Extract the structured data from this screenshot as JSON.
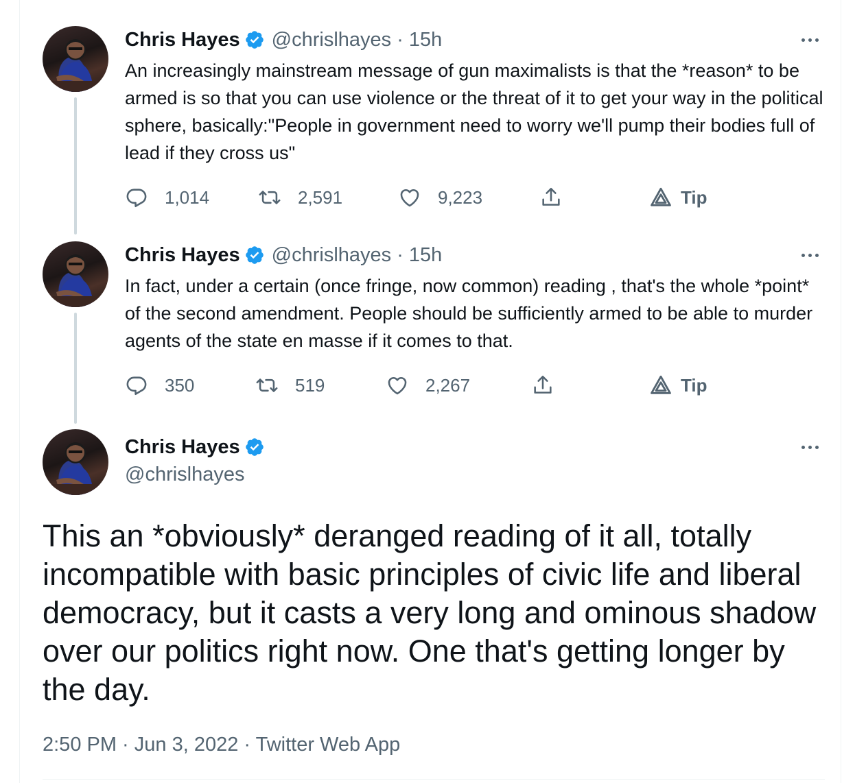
{
  "tweets": [
    {
      "name": "Chris Hayes",
      "meta": "@chrislhayes · 15h",
      "text": "An increasingly mainstream message of gun maximalists is that the *reason* to be armed is so that you can use violence or the threat of it to get your way in the political sphere, basically:\"People in government need to worry we'll pump their bodies full of lead if they cross us\"",
      "replies": "1,014",
      "retweets": "2,591",
      "likes": "9,223",
      "tip": "Tip"
    },
    {
      "name": "Chris Hayes",
      "meta": "@chrislhayes · 15h",
      "text": "In fact, under a certain (once fringe, now common) reading , that's the whole *point* of the second amendment. People should be sufficiently armed to be able to murder agents of the state en masse if it comes to that.",
      "replies": "350",
      "retweets": "519",
      "likes": "2,267",
      "tip": "Tip"
    }
  ],
  "main": {
    "name": "Chris Hayes",
    "handle": "@chrislhayes",
    "text": "This an *obviously* deranged reading of it all, totally incompatible with basic principles of civic life and liberal democracy, but it casts a very long and ominous shadow over our politics right now. One that's getting longer by the day.",
    "timestamp": "2:50 PM · Jun 3, 2022 · Twitter Web App"
  },
  "colors": {
    "verified": "#1d9bf0",
    "secondary_text": "#536471",
    "thread_line": "#cfd9de"
  },
  "icons": {
    "reply": "speech-bubble-icon",
    "retweet": "retweet-icon",
    "like": "heart-icon",
    "share": "share-icon",
    "tip": "tip-icon",
    "more": "more-dots-icon",
    "verified": "verified-badge-icon"
  }
}
